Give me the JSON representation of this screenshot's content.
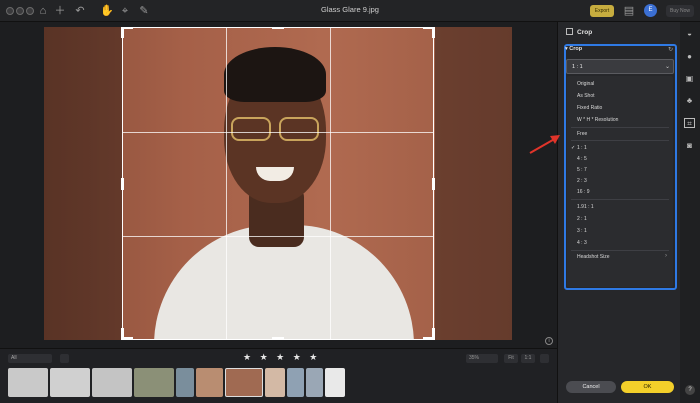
{
  "window": {
    "title": "Glass Glare 9.jpg"
  },
  "topbar": {
    "export_label": "Export",
    "avatar_initial": "E",
    "buy_label": "Buy Now"
  },
  "filmstrip": {
    "filter_label": "All",
    "rating_stars": "★ ★ ★ ★ ★",
    "zoom_label": "35%",
    "fit_label": "Fit",
    "fill_label": "1:1",
    "thumbnails": [
      "#c9c9c9",
      "#d0d0d0",
      "#c4c4c4",
      "#8b9077",
      "#7a8e9c",
      "#b98d71",
      "#a06a52",
      "#d3b9a5",
      "#8fa1b3",
      "#9aa7b5",
      "#e9e9e9"
    ]
  },
  "panel": {
    "header": "Crop",
    "section_title": "Crop",
    "ratio_selected": "1 : 1",
    "menu_items": [
      "Original",
      "As Shot",
      "Fixed Ratio",
      "W * H * Resolution",
      "Free",
      "1 : 1",
      "4 : 5",
      "5 : 7",
      "2 : 3",
      "16 : 9",
      "1.91 : 1",
      "2 : 1",
      "3 : 1",
      "4 : 3",
      "Headshot Size"
    ],
    "cancel_label": "Cancel",
    "ok_label": "OK"
  },
  "colors": {
    "accent_blue": "#2f7ae5",
    "ok_yellow": "#f3cf2a",
    "arrow_red": "#e0342a"
  }
}
